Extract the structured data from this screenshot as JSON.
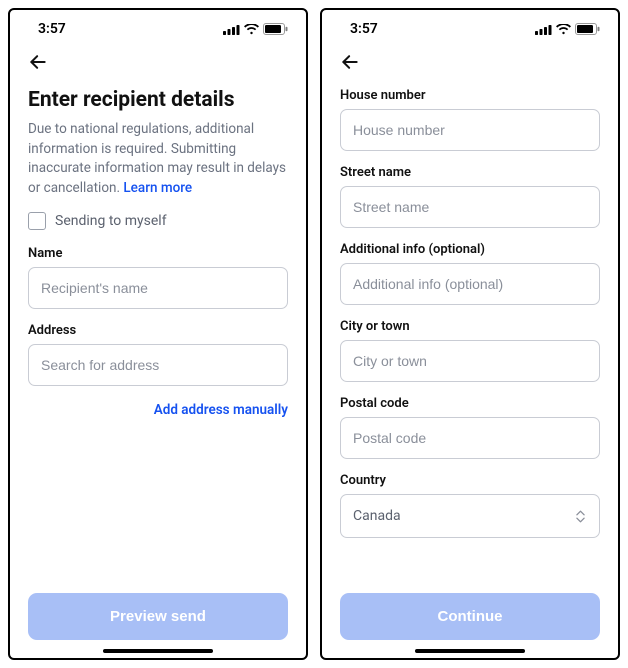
{
  "status": {
    "time": "3:57"
  },
  "left": {
    "title": "Enter recipient details",
    "subtitle_pre": "Due to national regulations, additional information is required. Submitting inaccurate information may result in delays or cancellation. ",
    "learn_more": "Learn more",
    "checkbox_label": "Sending to myself",
    "name_label": "Name",
    "name_placeholder": "Recipient's name",
    "address_label": "Address",
    "address_placeholder": "Search for address",
    "manual_link": "Add address manually",
    "cta": "Preview send"
  },
  "right": {
    "house_label": "House number",
    "house_placeholder": "House number",
    "street_label": "Street name",
    "street_placeholder": "Street name",
    "additional_label": "Additional info (optional)",
    "additional_placeholder": "Additional info (optional)",
    "city_label": "City or town",
    "city_placeholder": "City or town",
    "postal_label": "Postal code",
    "postal_placeholder": "Postal code",
    "country_label": "Country",
    "country_value": "Canada",
    "cta": "Continue"
  }
}
